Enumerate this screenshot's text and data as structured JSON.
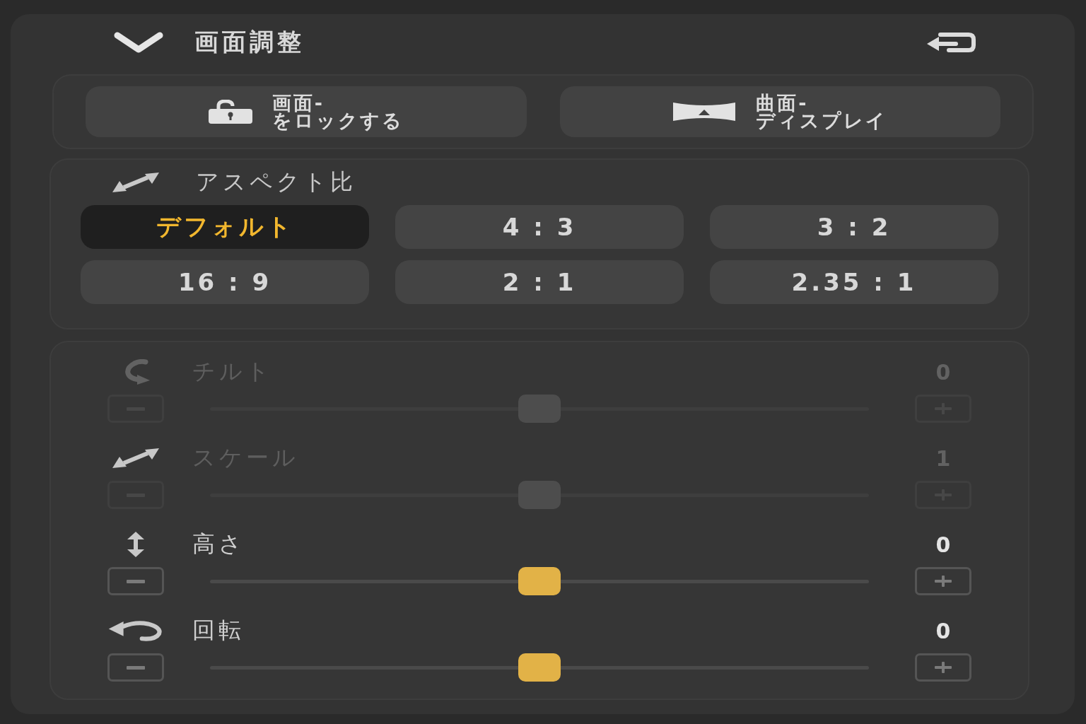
{
  "panel": {
    "title": "画面調整",
    "expanded": true
  },
  "actions": [
    {
      "kind": "lock",
      "lines": [
        "画面-",
        "をロックする"
      ]
    },
    {
      "kind": "curved",
      "lines": [
        "曲面-",
        "ディスプレイ"
      ]
    }
  ],
  "aspect_ratio": {
    "label": "アスペクト比",
    "options": [
      {
        "label": "デフォルト",
        "selected": true
      },
      {
        "label": "4 : 3",
        "selected": false
      },
      {
        "label": "3 : 2",
        "selected": false
      },
      {
        "label": "16 : 9",
        "selected": false
      },
      {
        "label": "2 : 1",
        "selected": false
      },
      {
        "label": "2.35 : 1",
        "selected": false
      }
    ]
  },
  "sliders": [
    {
      "kind": "tilt",
      "label": "チルト",
      "value": "0",
      "level": 0.5,
      "disabled": true
    },
    {
      "kind": "scale",
      "label": "スケール",
      "value": "1",
      "level": 0.5,
      "disabled": true
    },
    {
      "kind": "height",
      "label": "高さ",
      "value": "0",
      "level": 0.5,
      "disabled": false
    },
    {
      "kind": "rotation",
      "label": "回転",
      "value": "0",
      "level": 0.5,
      "disabled": false
    }
  ]
}
